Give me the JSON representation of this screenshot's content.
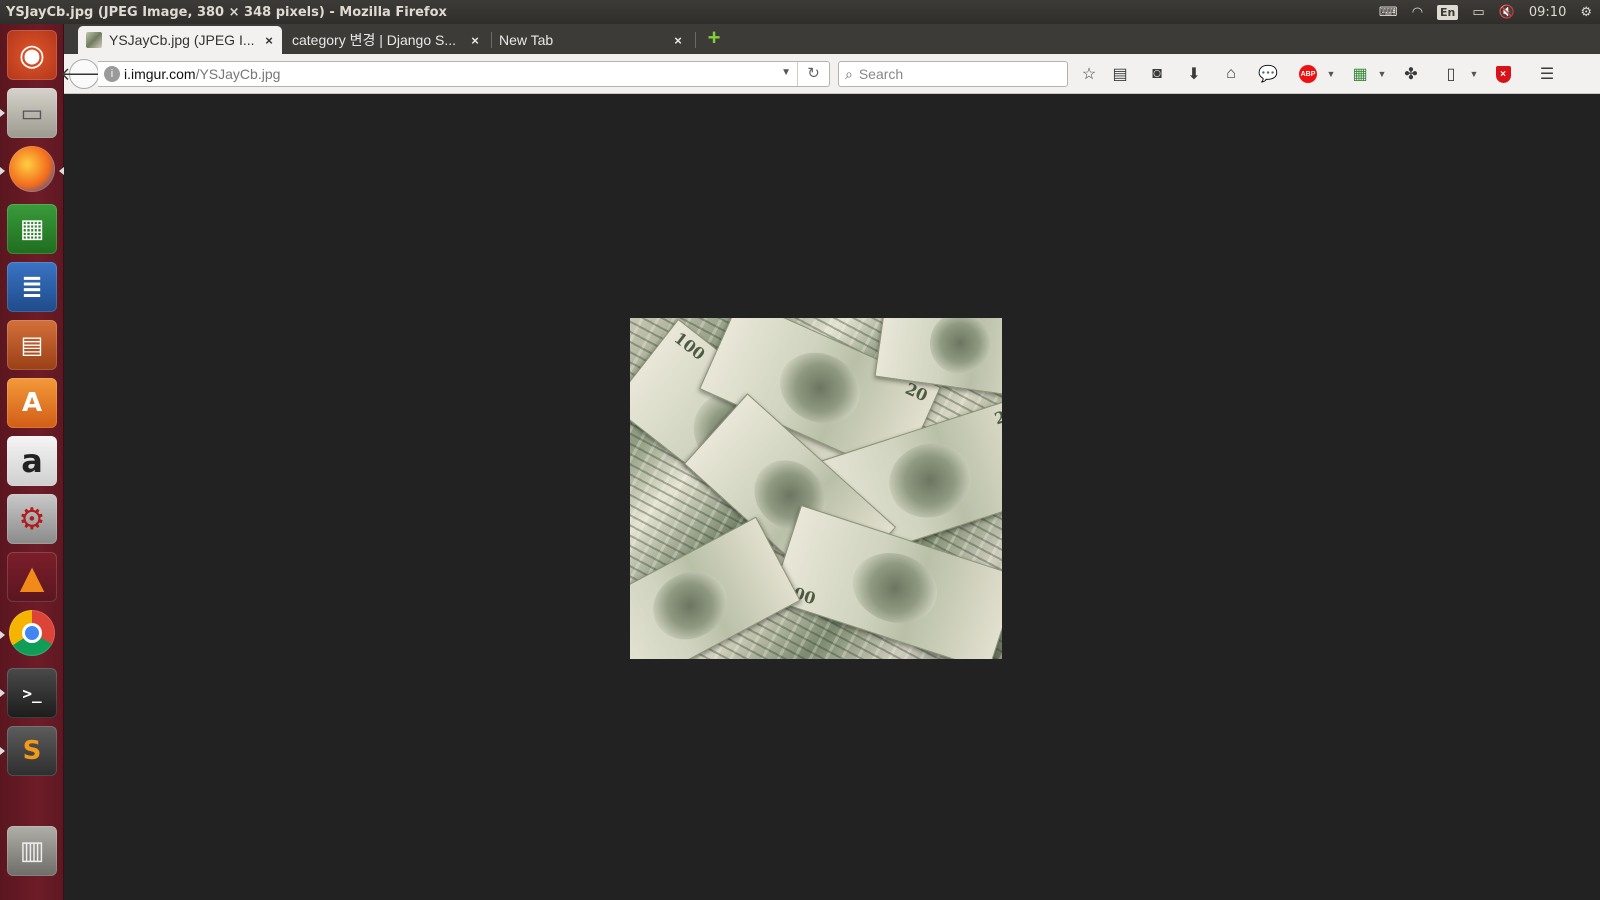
{
  "window": {
    "title": "YSJayCb.jpg (JPEG Image, 380 × 348 pixels) - Mozilla Firefox"
  },
  "tray": {
    "lang": "En",
    "time": "09:10"
  },
  "launcher": {
    "apps": [
      {
        "name": "ubuntu-dash",
        "glyph": "◉"
      },
      {
        "name": "files",
        "glyph": "▭"
      },
      {
        "name": "firefox",
        "glyph": "◍"
      },
      {
        "name": "libreoffice-calc",
        "glyph": "▦"
      },
      {
        "name": "libreoffice-writer",
        "glyph": "≣"
      },
      {
        "name": "libreoffice-impress",
        "glyph": "▤"
      },
      {
        "name": "software-center",
        "glyph": "A"
      },
      {
        "name": "amazon",
        "glyph": "a"
      },
      {
        "name": "system-settings",
        "glyph": "⚙"
      },
      {
        "name": "vlc",
        "glyph": "▲"
      },
      {
        "name": "chrome",
        "glyph": "◎"
      },
      {
        "name": "terminal",
        "glyph": ">_"
      },
      {
        "name": "sublime-text",
        "glyph": "S"
      },
      {
        "name": "trash",
        "glyph": "🗑"
      }
    ]
  },
  "tabs": [
    {
      "label": "YSJayCb.jpg (JPEG I...",
      "close": "×"
    },
    {
      "label": "category 변경 | Django S...",
      "close": "×"
    },
    {
      "label": "New Tab",
      "close": "×"
    }
  ],
  "newtab": "+",
  "urlbar": {
    "host": "i.imgur.com",
    "path": "/YSJayCb.jpg"
  },
  "search": {
    "placeholder": "Search"
  },
  "toolbar": {
    "abp_label": "ABP",
    "shield_label": "×"
  },
  "image": {
    "subject": "pile of hundred dollar bills"
  }
}
